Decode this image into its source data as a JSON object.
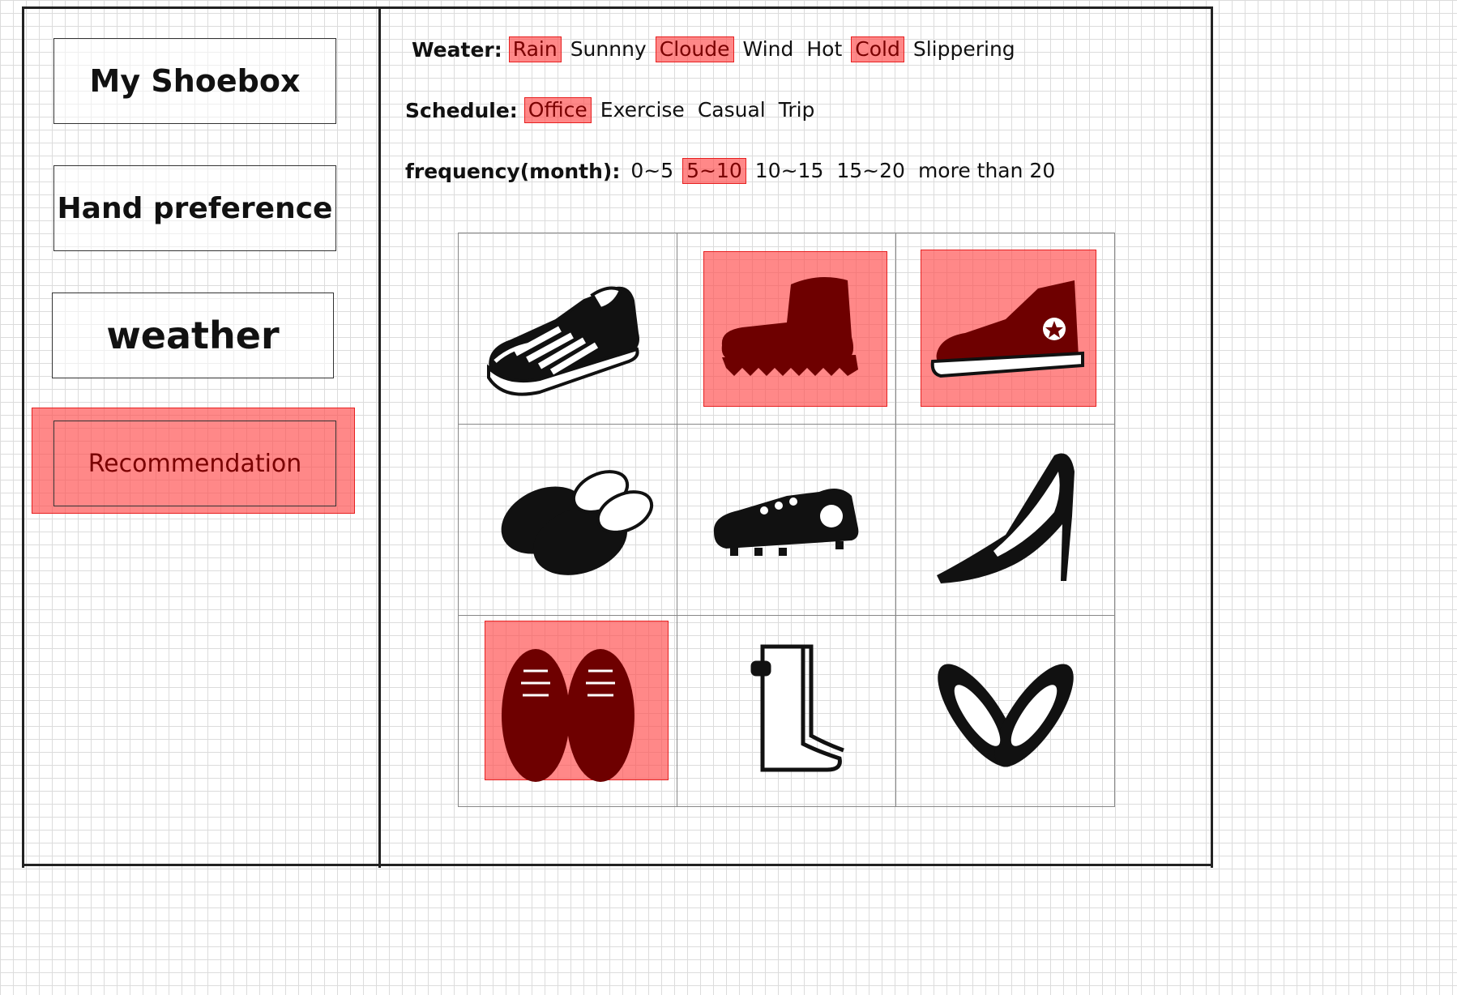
{
  "sidebar": {
    "items": [
      {
        "label": "My Shoebox"
      },
      {
        "label": "Hand preference"
      },
      {
        "label": "weather"
      },
      {
        "label": "Recommendation",
        "selected": true
      }
    ]
  },
  "filters": {
    "weather": {
      "label": "Weater:",
      "options": [
        {
          "text": "Rain",
          "selected": true
        },
        {
          "text": "Sunnny",
          "selected": false
        },
        {
          "text": "Cloude",
          "selected": true
        },
        {
          "text": "Wind",
          "selected": false
        },
        {
          "text": "Hot",
          "selected": false
        },
        {
          "text": "Cold",
          "selected": true
        },
        {
          "text": "Slippering",
          "selected": false
        }
      ]
    },
    "schedule": {
      "label": "Schedule:",
      "options": [
        {
          "text": "Office",
          "selected": true
        },
        {
          "text": "Exercise",
          "selected": false
        },
        {
          "text": "Casual",
          "selected": false
        },
        {
          "text": "Trip",
          "selected": false
        }
      ]
    },
    "frequency": {
      "label": "frequency(month):",
      "options": [
        {
          "text": "0~5",
          "selected": false
        },
        {
          "text": "5~10",
          "selected": true
        },
        {
          "text": "10~15",
          "selected": false
        },
        {
          "text": "15~20",
          "selected": false
        },
        {
          "text": "more than 20",
          "selected": false
        }
      ]
    }
  },
  "shoes": [
    {
      "icon": "sneaker-icon",
      "selected": false
    },
    {
      "icon": "hiking-boot-icon",
      "selected": true
    },
    {
      "icon": "high-top-sneaker-icon",
      "selected": true
    },
    {
      "icon": "slippers-icon",
      "selected": false
    },
    {
      "icon": "cleat-icon",
      "selected": false
    },
    {
      "icon": "high-heel-icon",
      "selected": false
    },
    {
      "icon": "dress-shoes-icon",
      "selected": true
    },
    {
      "icon": "rain-boots-icon",
      "selected": false
    },
    {
      "icon": "ballet-flats-icon",
      "selected": false
    }
  ],
  "colors": {
    "highlight": "#ff5050",
    "highlight_border": "#e62020",
    "highlight_text": "#7a0000"
  }
}
